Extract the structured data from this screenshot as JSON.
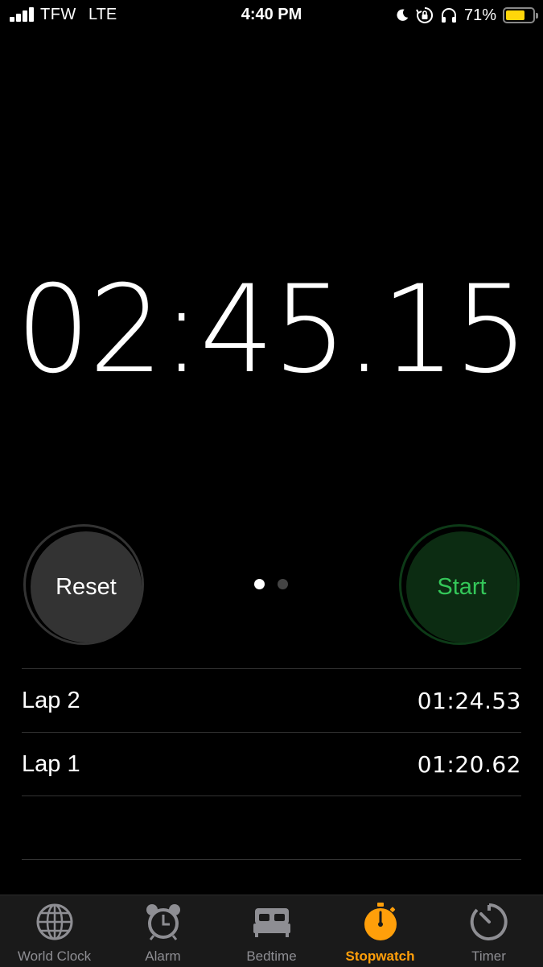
{
  "status_bar": {
    "carrier": "TFW",
    "network": "LTE",
    "time": "4:40 PM",
    "battery_percent": "71%",
    "battery_level": 0.71,
    "icons": [
      "signal-icon",
      "moon-icon",
      "orientation-lock-icon",
      "headphones-icon",
      "battery-icon"
    ]
  },
  "stopwatch": {
    "elapsed": "02:45.15",
    "reset_label": "Reset",
    "start_label": "Start",
    "page_indicator": {
      "count": 2,
      "active": 1
    }
  },
  "laps": [
    {
      "label": "Lap 2",
      "time": "01:24.53"
    },
    {
      "label": "Lap 1",
      "time": "01:20.62"
    }
  ],
  "tabs": [
    {
      "label": "World Clock",
      "icon": "globe-icon"
    },
    {
      "label": "Alarm",
      "icon": "alarm-clock-icon"
    },
    {
      "label": "Bedtime",
      "icon": "bed-icon"
    },
    {
      "label": "Stopwatch",
      "icon": "stopwatch-icon",
      "active": true
    },
    {
      "label": "Timer",
      "icon": "timer-icon"
    }
  ],
  "colors": {
    "background": "#000000",
    "start_green": "#34c759",
    "active_tab": "#ff9f0a",
    "inactive_tab": "#8e8e93",
    "battery_yellow": "#ffd60a"
  }
}
